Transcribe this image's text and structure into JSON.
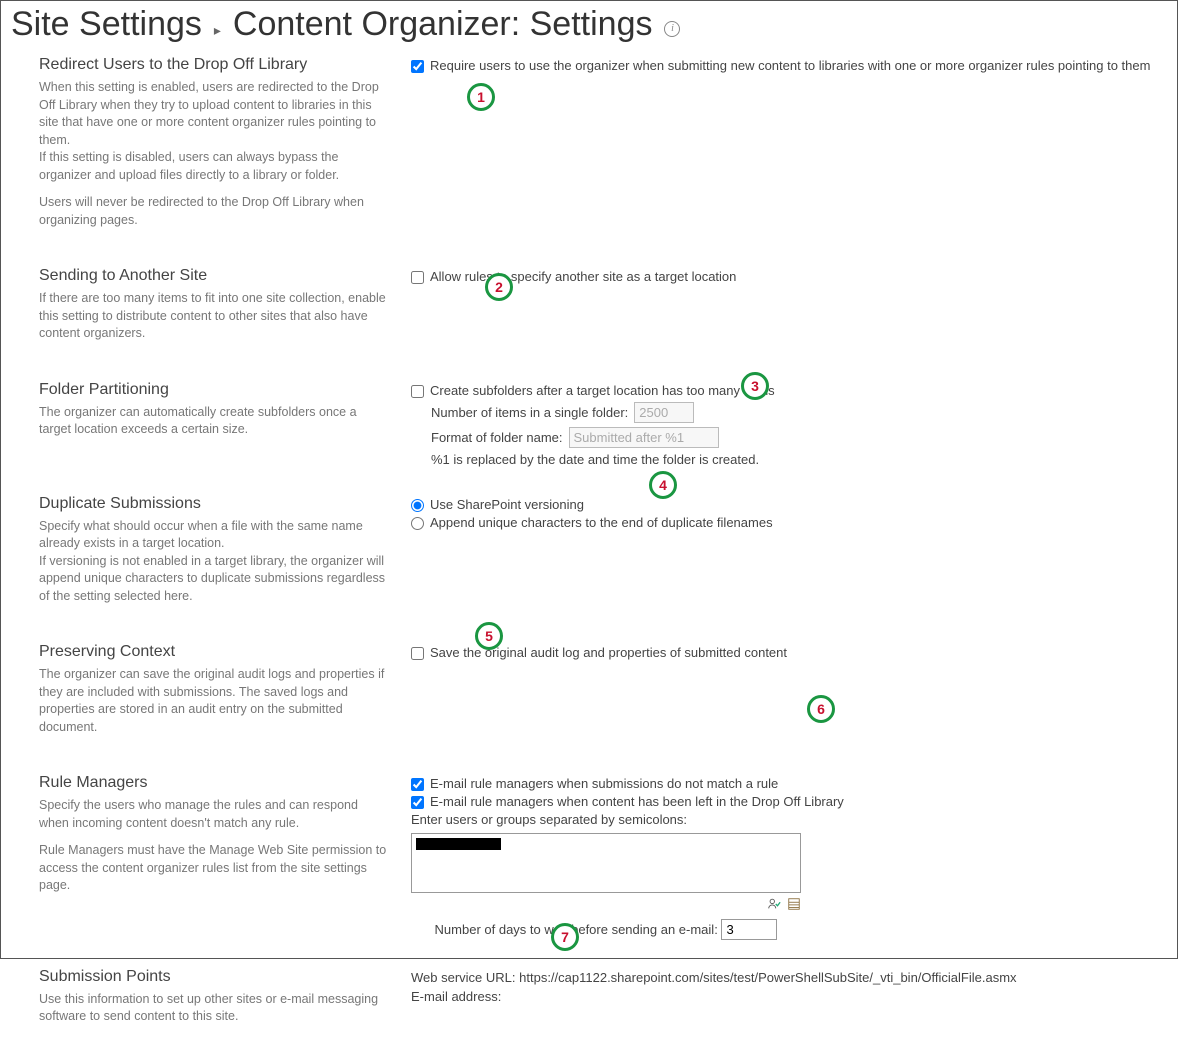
{
  "header": {
    "crumb": "Site Settings",
    "title": "Content Organizer: Settings"
  },
  "sections": {
    "redirect": {
      "title": "Redirect Users to the Drop Off Library",
      "desc1": "When this setting is enabled, users are redirected to the Drop Off Library when they try to upload content to libraries in this site that have one or more content organizer rules pointing to them.",
      "desc2": "If this setting is disabled, users can always bypass the organizer and upload files directly to a library or folder.",
      "desc3": "Users will never be redirected to the Drop Off Library when organizing pages.",
      "cb_label": "Require users to use the organizer when submitting new content to libraries with one or more organizer rules pointing to them",
      "cb_checked": true
    },
    "sending": {
      "title": "Sending to Another Site",
      "desc": "If there are too many items to fit into one site collection, enable this setting to distribute content to other sites that also have content organizers.",
      "cb_label": "Allow rules to specify another site as a target location",
      "cb_checked": false
    },
    "folder": {
      "title": "Folder Partitioning",
      "desc": "The organizer can automatically create subfolders once a target location exceeds a certain size.",
      "cb_label": "Create subfolders after a target location has too many items",
      "cb_checked": false,
      "num_label": "Number of items in a single folder:",
      "num_value": "2500",
      "format_label": "Format of folder name:",
      "format_value": "Submitted after %1",
      "note": "%1 is replaced by the date and time the folder is created."
    },
    "duplicate": {
      "title": "Duplicate Submissions",
      "desc1": "Specify what should occur when a file with the same name already exists in a target location.",
      "desc2": "If versioning is not enabled in a target library, the organizer will append unique characters to duplicate submissions regardless of the setting selected here.",
      "r1_label": "Use SharePoint versioning",
      "r2_label": "Append unique characters to the end of duplicate filenames",
      "selected": "versioning"
    },
    "preserve": {
      "title": "Preserving Context",
      "desc": "The organizer can save the original audit logs and properties if they are included with submissions. The saved logs and properties are stored in an audit entry on the submitted document.",
      "cb_label": "Save the original audit log and properties of submitted content",
      "cb_checked": false
    },
    "managers": {
      "title": "Rule Managers",
      "desc1": "Specify the users who manage the rules and can respond when incoming content doesn't match any rule.",
      "desc2": "Rule Managers must have the Manage Web Site permission to access the content organizer rules list from the site settings page.",
      "cb1_label": "E-mail rule managers when submissions do not match a rule",
      "cb1_checked": true,
      "cb2_label": "E-mail rule managers when content has been left in the Drop Off Library",
      "cb2_checked": true,
      "picker_label": "Enter users or groups separated by semicolons:",
      "days_label": "Number of days to wait before sending an e-mail:",
      "days_value": "3"
    },
    "submission": {
      "title": "Submission Points",
      "desc": "Use this information to set up other sites or e-mail messaging software to send content to this site.",
      "url_label": "Web service URL:",
      "url_value": "https://cap1122.sharepoint.com/sites/test/PowerShellSubSite/_vti_bin/OfficialFile.asmx",
      "email_label": "E-mail address:",
      "email_value": ""
    }
  },
  "annotations": {
    "1": "1",
    "2": "2",
    "3": "3",
    "4": "4",
    "5": "5",
    "6": "6",
    "7": "7"
  }
}
